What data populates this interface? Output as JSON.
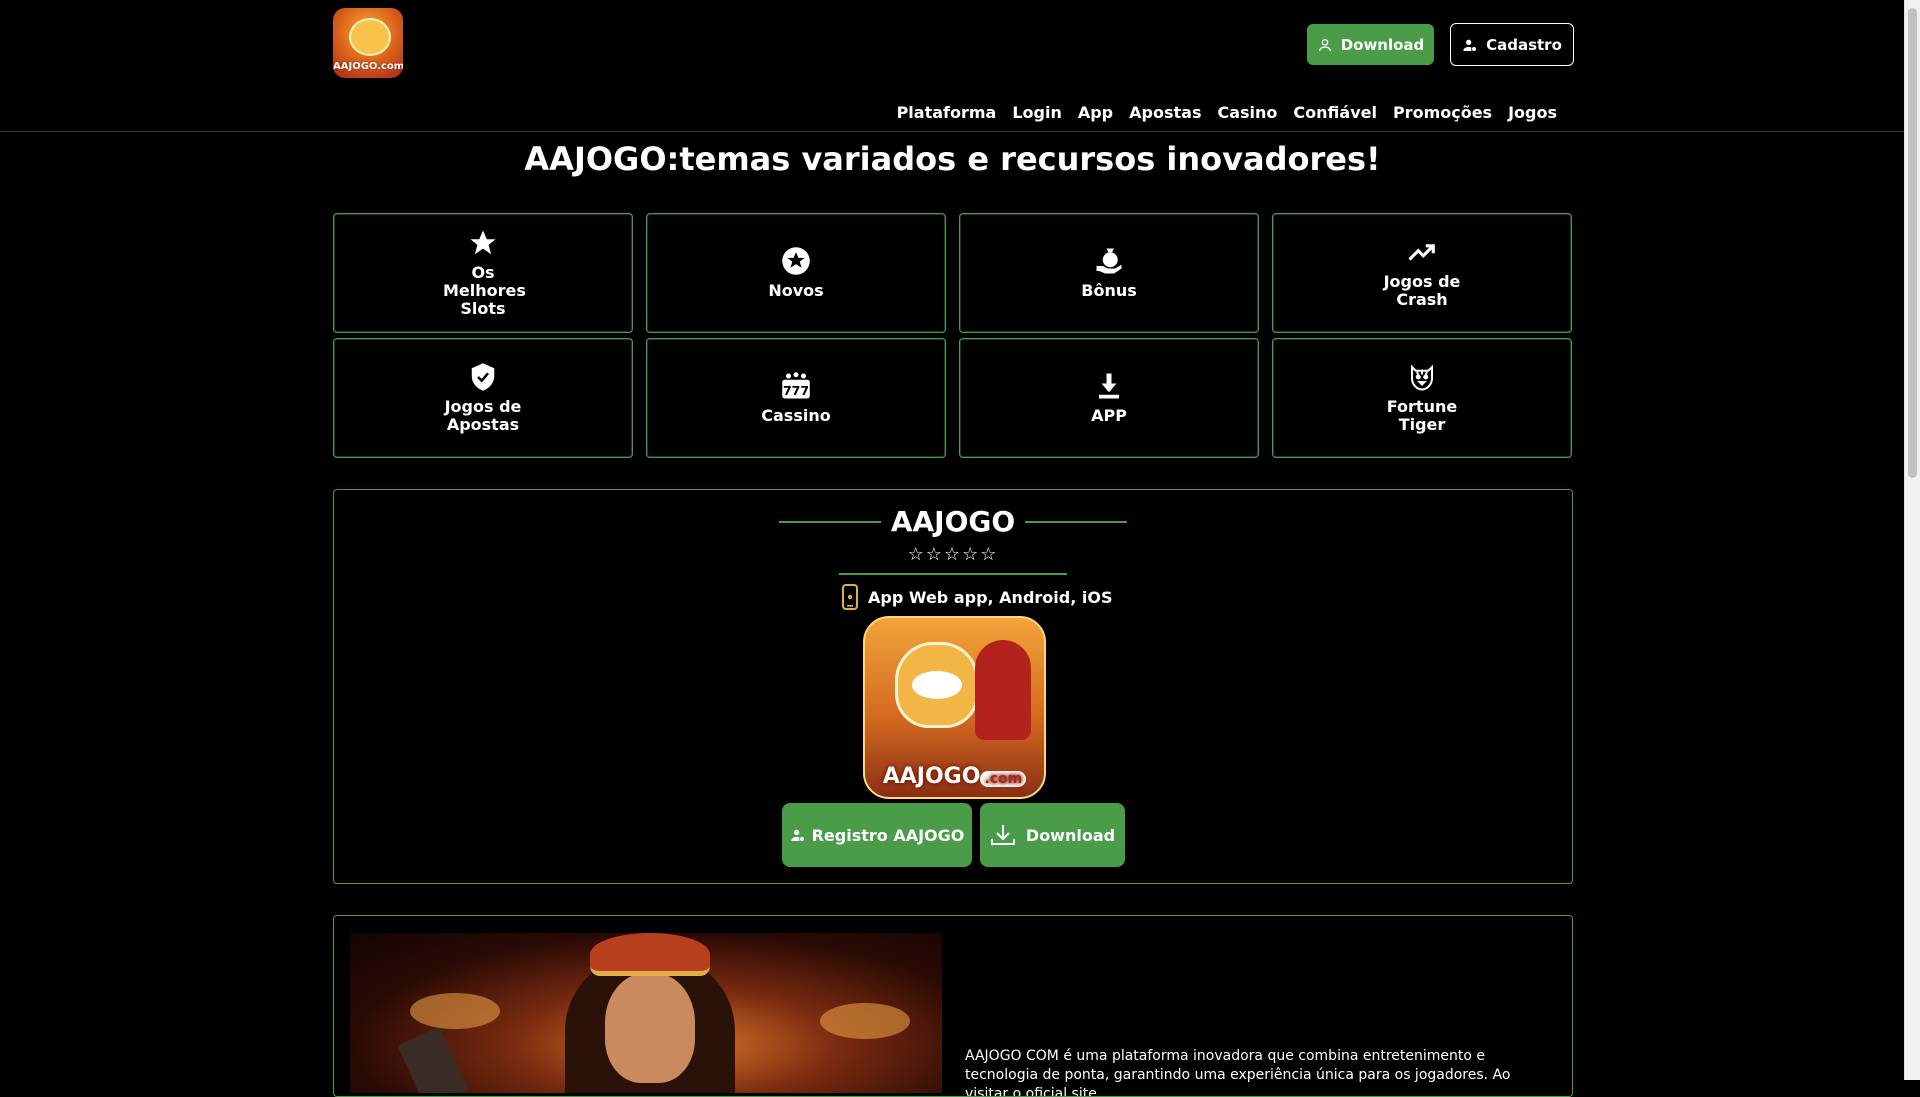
{
  "header": {
    "logo_text": "AAJOGO.com",
    "download_label": "Download",
    "cadastro_label": "Cadastro",
    "nav": [
      "Plataforma",
      "Login",
      "App",
      "Apostas",
      "Casino",
      "Confiável",
      "Promoções",
      "Jogos"
    ]
  },
  "page_title": "AAJOGO:temas variados e recursos inovadores!",
  "tiles": [
    {
      "label": "Os Melhores Slots",
      "icon": "star-icon"
    },
    {
      "label": "Novos",
      "icon": "star-circle-icon"
    },
    {
      "label": "Bônus",
      "icon": "money-bag-hand-icon"
    },
    {
      "label": "Jogos de Crash",
      "icon": "trending-up-icon"
    },
    {
      "label": "Jogos de Apostas",
      "icon": "shield-check-icon"
    },
    {
      "label": "Cassino",
      "icon": "slot-777-icon"
    },
    {
      "label": "APP",
      "icon": "download-icon"
    },
    {
      "label": "Fortune Tiger",
      "icon": "tiger-icon"
    }
  ],
  "app_card": {
    "title": "AAJOGO",
    "rating_stars": "☆☆☆☆☆",
    "platforms": "App Web app, Android, iOS",
    "app_image_brand": "AAJOGO",
    "app_image_brand_suffix": ".com",
    "registro_label": "Registro AAJOGO",
    "download_label": "Download"
  },
  "intro": {
    "text": "AAJOGO COM é uma plataforma inovadora que combina entretenimento e tecnologia de ponta, garantindo uma experiência única para os jogadores. Ao visitar o oficial site"
  },
  "colors": {
    "background": "#000000",
    "accent_green": "#4a9c49",
    "text": "#ffffff"
  }
}
